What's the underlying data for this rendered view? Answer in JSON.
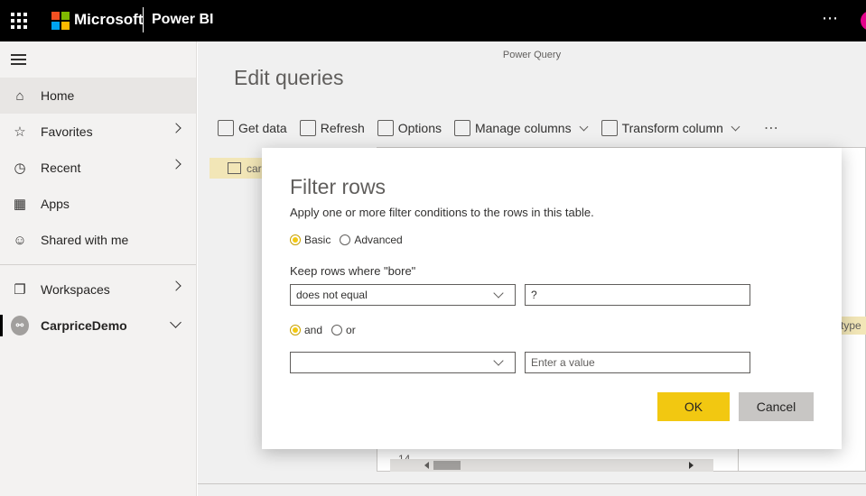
{
  "topbar": {
    "brand": "Microsoft",
    "product": "Power BI",
    "more": "⋯",
    "ms_colors": [
      "#f25022",
      "#7fba00",
      "#00a4ef",
      "#ffb900"
    ]
  },
  "sidebar": {
    "items": [
      {
        "label": "Home",
        "icon": "home-icon",
        "glyph": "⌂"
      },
      {
        "label": "Favorites",
        "icon": "star-icon",
        "glyph": "☆"
      },
      {
        "label": "Recent",
        "icon": "clock-icon",
        "glyph": "◷"
      },
      {
        "label": "Apps",
        "icon": "apps-icon",
        "glyph": "▦"
      },
      {
        "label": "Shared with me",
        "icon": "shared-icon",
        "glyph": "☺"
      },
      {
        "label": "Workspaces",
        "icon": "workspaces-icon",
        "glyph": "❐"
      },
      {
        "label": "CarpriceDemo",
        "icon": "workspace-avatar-icon"
      }
    ]
  },
  "power_query": {
    "title": "Power Query",
    "heading": "Edit queries",
    "toolbar": {
      "get_data": "Get data",
      "refresh": "Refresh",
      "options": "Options",
      "manage_columns": "Manage columns",
      "transform_column": "Transform column",
      "more": "⋯"
    },
    "query_name": "car",
    "type_label": "type",
    "row_number": "14"
  },
  "dialog": {
    "title": "Filter rows",
    "description": "Apply one or more filter conditions to the rows in this table.",
    "mode_basic": "Basic",
    "mode_advanced": "Advanced",
    "keep_label": "Keep rows where \"bore\"",
    "condition1_operator": "does not equal",
    "condition1_value": "?",
    "and_label": "and",
    "or_label": "or",
    "condition2_operator": "",
    "condition2_placeholder": "Enter a value",
    "ok": "OK",
    "cancel": "Cancel"
  },
  "colors": {
    "accent_yellow": "#f2c811",
    "topbar": "#000000"
  }
}
